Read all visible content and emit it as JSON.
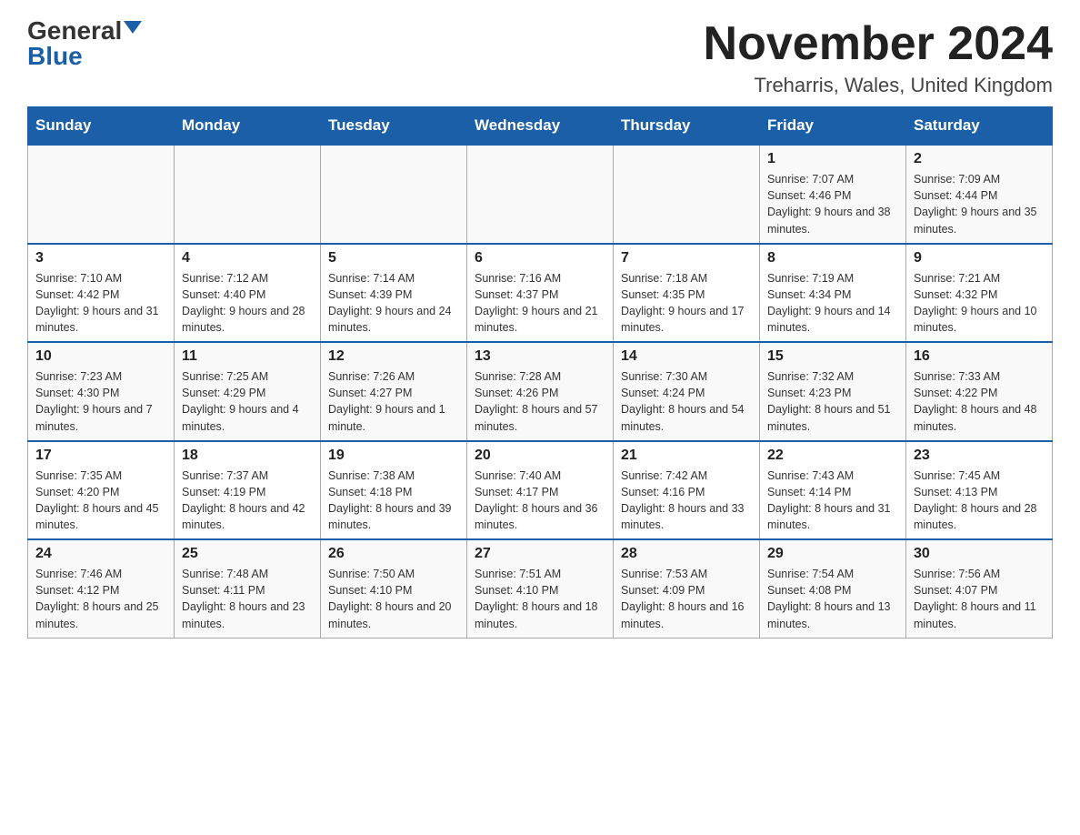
{
  "header": {
    "logo_general": "General",
    "logo_blue": "Blue",
    "month_title": "November 2024",
    "location": "Treharris, Wales, United Kingdom"
  },
  "days_of_week": [
    "Sunday",
    "Monday",
    "Tuesday",
    "Wednesday",
    "Thursday",
    "Friday",
    "Saturday"
  ],
  "weeks": [
    [
      {
        "day": "",
        "info": ""
      },
      {
        "day": "",
        "info": ""
      },
      {
        "day": "",
        "info": ""
      },
      {
        "day": "",
        "info": ""
      },
      {
        "day": "",
        "info": ""
      },
      {
        "day": "1",
        "info": "Sunrise: 7:07 AM\nSunset: 4:46 PM\nDaylight: 9 hours and 38 minutes."
      },
      {
        "day": "2",
        "info": "Sunrise: 7:09 AM\nSunset: 4:44 PM\nDaylight: 9 hours and 35 minutes."
      }
    ],
    [
      {
        "day": "3",
        "info": "Sunrise: 7:10 AM\nSunset: 4:42 PM\nDaylight: 9 hours and 31 minutes."
      },
      {
        "day": "4",
        "info": "Sunrise: 7:12 AM\nSunset: 4:40 PM\nDaylight: 9 hours and 28 minutes."
      },
      {
        "day": "5",
        "info": "Sunrise: 7:14 AM\nSunset: 4:39 PM\nDaylight: 9 hours and 24 minutes."
      },
      {
        "day": "6",
        "info": "Sunrise: 7:16 AM\nSunset: 4:37 PM\nDaylight: 9 hours and 21 minutes."
      },
      {
        "day": "7",
        "info": "Sunrise: 7:18 AM\nSunset: 4:35 PM\nDaylight: 9 hours and 17 minutes."
      },
      {
        "day": "8",
        "info": "Sunrise: 7:19 AM\nSunset: 4:34 PM\nDaylight: 9 hours and 14 minutes."
      },
      {
        "day": "9",
        "info": "Sunrise: 7:21 AM\nSunset: 4:32 PM\nDaylight: 9 hours and 10 minutes."
      }
    ],
    [
      {
        "day": "10",
        "info": "Sunrise: 7:23 AM\nSunset: 4:30 PM\nDaylight: 9 hours and 7 minutes."
      },
      {
        "day": "11",
        "info": "Sunrise: 7:25 AM\nSunset: 4:29 PM\nDaylight: 9 hours and 4 minutes."
      },
      {
        "day": "12",
        "info": "Sunrise: 7:26 AM\nSunset: 4:27 PM\nDaylight: 9 hours and 1 minute."
      },
      {
        "day": "13",
        "info": "Sunrise: 7:28 AM\nSunset: 4:26 PM\nDaylight: 8 hours and 57 minutes."
      },
      {
        "day": "14",
        "info": "Sunrise: 7:30 AM\nSunset: 4:24 PM\nDaylight: 8 hours and 54 minutes."
      },
      {
        "day": "15",
        "info": "Sunrise: 7:32 AM\nSunset: 4:23 PM\nDaylight: 8 hours and 51 minutes."
      },
      {
        "day": "16",
        "info": "Sunrise: 7:33 AM\nSunset: 4:22 PM\nDaylight: 8 hours and 48 minutes."
      }
    ],
    [
      {
        "day": "17",
        "info": "Sunrise: 7:35 AM\nSunset: 4:20 PM\nDaylight: 8 hours and 45 minutes."
      },
      {
        "day": "18",
        "info": "Sunrise: 7:37 AM\nSunset: 4:19 PM\nDaylight: 8 hours and 42 minutes."
      },
      {
        "day": "19",
        "info": "Sunrise: 7:38 AM\nSunset: 4:18 PM\nDaylight: 8 hours and 39 minutes."
      },
      {
        "day": "20",
        "info": "Sunrise: 7:40 AM\nSunset: 4:17 PM\nDaylight: 8 hours and 36 minutes."
      },
      {
        "day": "21",
        "info": "Sunrise: 7:42 AM\nSunset: 4:16 PM\nDaylight: 8 hours and 33 minutes."
      },
      {
        "day": "22",
        "info": "Sunrise: 7:43 AM\nSunset: 4:14 PM\nDaylight: 8 hours and 31 minutes."
      },
      {
        "day": "23",
        "info": "Sunrise: 7:45 AM\nSunset: 4:13 PM\nDaylight: 8 hours and 28 minutes."
      }
    ],
    [
      {
        "day": "24",
        "info": "Sunrise: 7:46 AM\nSunset: 4:12 PM\nDaylight: 8 hours and 25 minutes."
      },
      {
        "day": "25",
        "info": "Sunrise: 7:48 AM\nSunset: 4:11 PM\nDaylight: 8 hours and 23 minutes."
      },
      {
        "day": "26",
        "info": "Sunrise: 7:50 AM\nSunset: 4:10 PM\nDaylight: 8 hours and 20 minutes."
      },
      {
        "day": "27",
        "info": "Sunrise: 7:51 AM\nSunset: 4:10 PM\nDaylight: 8 hours and 18 minutes."
      },
      {
        "day": "28",
        "info": "Sunrise: 7:53 AM\nSunset: 4:09 PM\nDaylight: 8 hours and 16 minutes."
      },
      {
        "day": "29",
        "info": "Sunrise: 7:54 AM\nSunset: 4:08 PM\nDaylight: 8 hours and 13 minutes."
      },
      {
        "day": "30",
        "info": "Sunrise: 7:56 AM\nSunset: 4:07 PM\nDaylight: 8 hours and 11 minutes."
      }
    ]
  ]
}
